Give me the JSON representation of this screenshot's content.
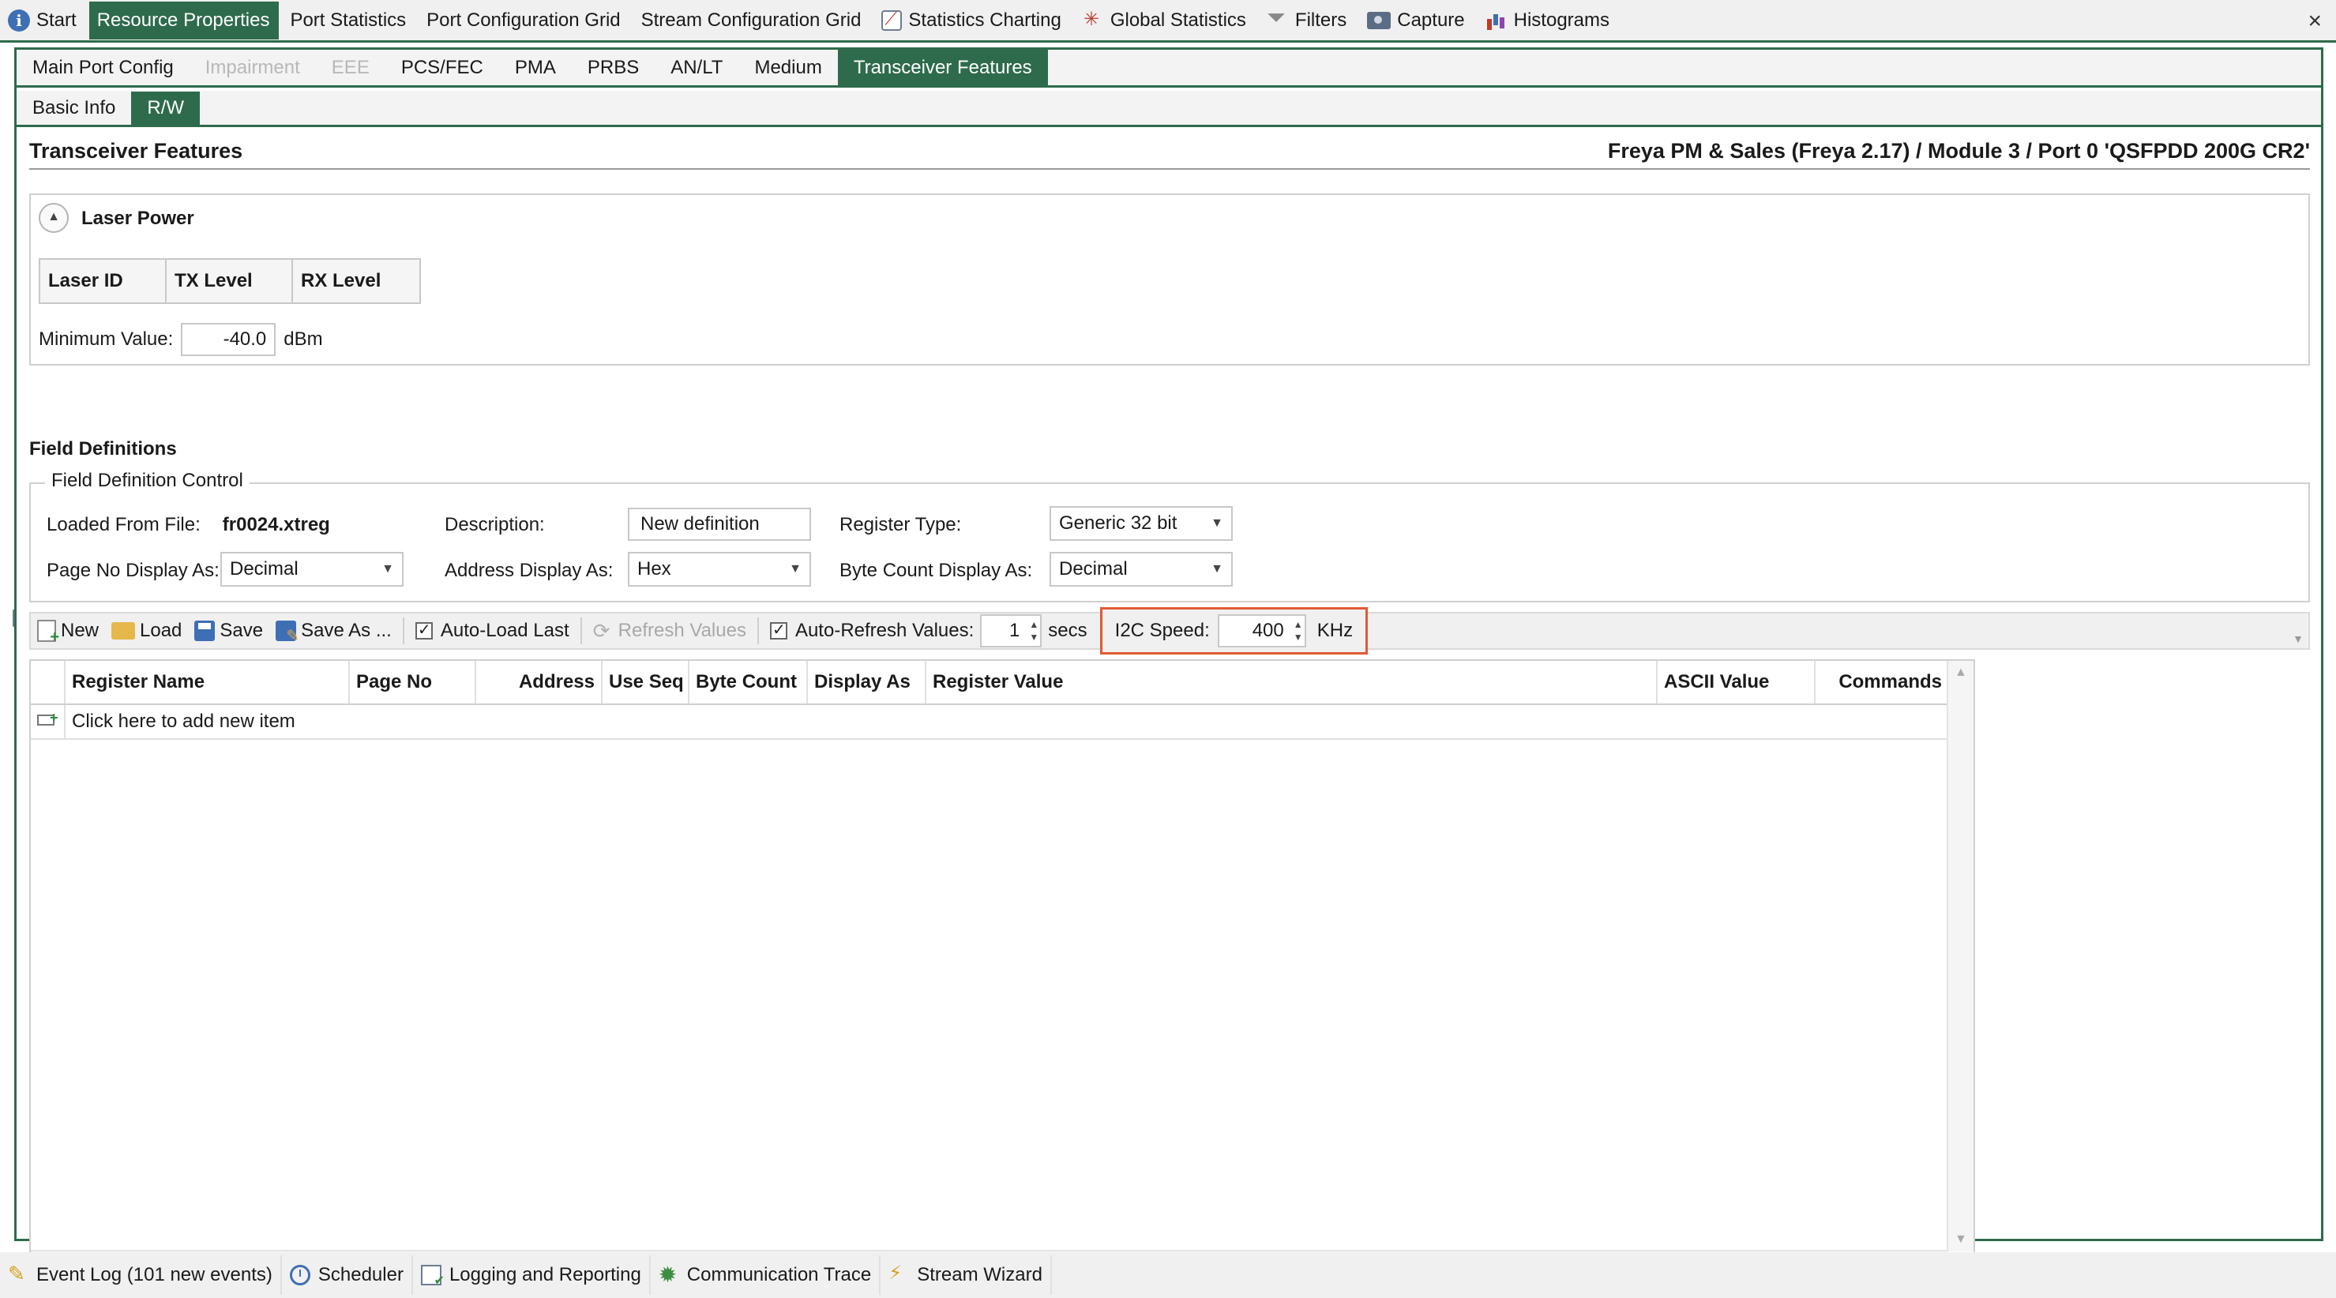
{
  "top_tabs": [
    {
      "label": "Start",
      "icon": "info-icon"
    },
    {
      "label": "Resource Properties",
      "icon": "properties-icon"
    },
    {
      "label": "Port Statistics",
      "icon": "grid-icon"
    },
    {
      "label": "Port Configuration Grid",
      "icon": "grid-icon"
    },
    {
      "label": "Stream Configuration Grid",
      "icon": "grid-edit-icon"
    },
    {
      "label": "Statistics Charting",
      "icon": "chart-icon"
    },
    {
      "label": "Global Statistics",
      "icon": "scatter-icon"
    },
    {
      "label": "Filters",
      "icon": "filter-icon"
    },
    {
      "label": "Capture",
      "icon": "camera-icon"
    },
    {
      "label": "Histograms",
      "icon": "histogram-icon"
    }
  ],
  "close_label": "×",
  "sub_tabs": [
    "Main Port Config",
    "Impairment",
    "EEE",
    "PCS/FEC",
    "PMA",
    "PRBS",
    "AN/LT",
    "Medium",
    "Transceiver Features"
  ],
  "inner_tabs": [
    "Basic Info",
    "R/W"
  ],
  "header": {
    "title": "Transceiver Features",
    "port_path": "Freya PM & Sales (Freya 2.17) / Module 3 / Port 0 'QSFPDD 200G CR2'"
  },
  "laser_power": {
    "title": "Laser Power",
    "columns": [
      "Laser ID",
      "TX Level",
      "RX Level"
    ],
    "min_label": "Minimum Value:",
    "min_value": "-40.0",
    "unit": "dBm"
  },
  "field_definitions": {
    "title": "Field Definitions",
    "group_title": "Field Definition Control",
    "loaded_from_label": "Loaded From File:",
    "loaded_from_value": "fr0024.xtreg",
    "description_label": "Description:",
    "description_value": "New definition",
    "register_type_label": "Register Type:",
    "register_type_value": "Generic 32 bit",
    "page_no_label": "Page No Display As:",
    "page_no_value": "Decimal",
    "address_label": "Address Display As:",
    "address_value": "Hex",
    "byte_count_label": "Byte Count Display As:",
    "byte_count_value": "Decimal"
  },
  "toolbar": {
    "new": "New",
    "load": "Load",
    "save": "Save",
    "save_as": "Save As ...",
    "auto_load_last": "Auto-Load Last",
    "refresh_values": "Refresh Values",
    "auto_refresh_values": "Auto-Refresh Values:",
    "refresh_interval": "1",
    "secs": "secs",
    "i2c_label": "I2C Speed:",
    "i2c_value": "400",
    "i2c_unit": "KHz"
  },
  "grid": {
    "columns": [
      "Register Name",
      "Page No",
      "Address",
      "Use Seq",
      "Byte Count",
      "Display As",
      "Register Value",
      "ASCII Value",
      "Commands"
    ],
    "add_item": "Click here to add new item"
  },
  "bottom_tabs": [
    {
      "label": "Event Log (101 new events)",
      "icon": "event-log-icon"
    },
    {
      "label": "Scheduler",
      "icon": "clock-icon"
    },
    {
      "label": "Logging and Reporting",
      "icon": "report-icon"
    },
    {
      "label": "Communication Trace",
      "icon": "gear-icon"
    },
    {
      "label": "Stream Wizard",
      "icon": "wand-icon"
    }
  ]
}
